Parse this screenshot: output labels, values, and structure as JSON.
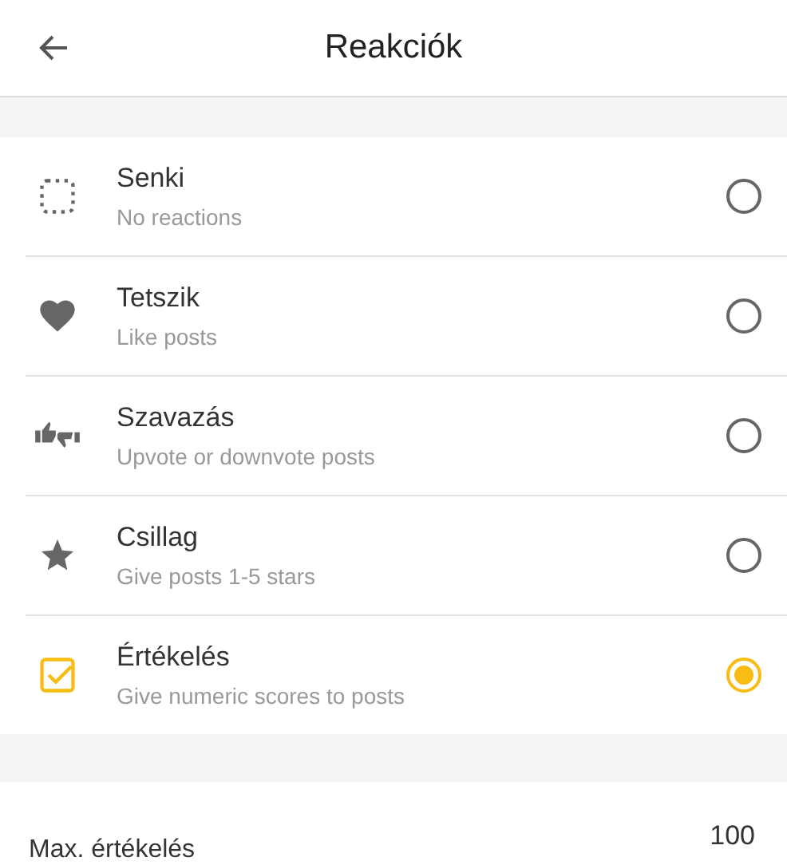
{
  "header": {
    "title": "Reakciók"
  },
  "options": [
    {
      "kind": "none",
      "title": "Senki",
      "subtitle": "No reactions",
      "selected": false
    },
    {
      "kind": "like",
      "title": "Tetszik",
      "subtitle": "Like posts",
      "selected": false
    },
    {
      "kind": "vote",
      "title": "Szavazás",
      "subtitle": "Upvote or downvote posts",
      "selected": false
    },
    {
      "kind": "star",
      "title": "Csillag",
      "subtitle": "Give posts 1-5 stars",
      "selected": false
    },
    {
      "kind": "score",
      "title": "Értékelés",
      "subtitle": "Give numeric scores to posts",
      "selected": true
    }
  ],
  "max_rating": {
    "label": "Max. értékelés",
    "value": "100"
  }
}
